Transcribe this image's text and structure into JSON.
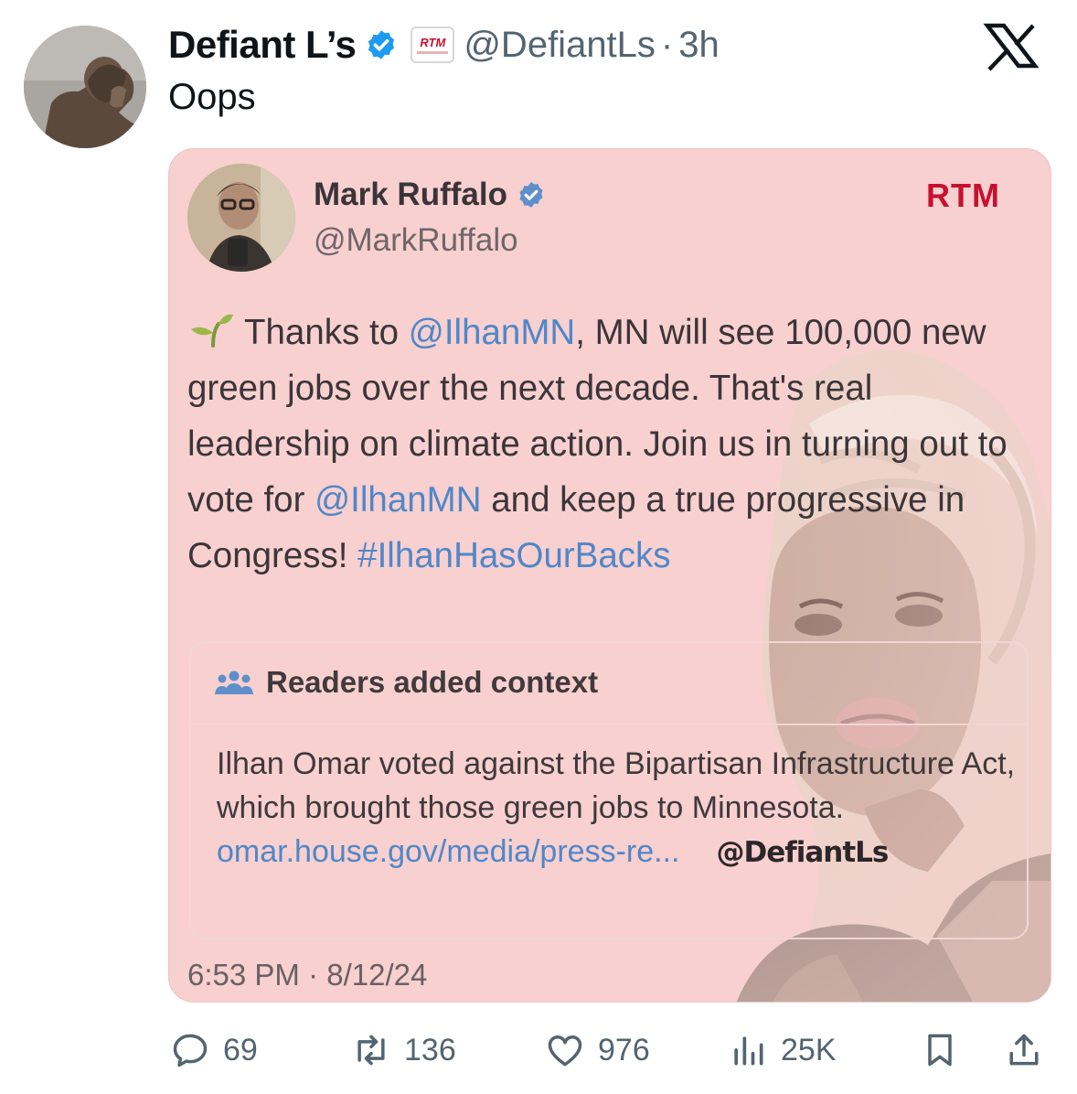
{
  "post": {
    "author_name": "Defiant L’s",
    "badge_text": "RTM",
    "handle": "@DefiantLs",
    "separator": "·",
    "time_ago": "3h",
    "text": "Oops"
  },
  "quoted_post": {
    "author_name": "Mark Ruffalo",
    "handle": "@MarkRuffalo",
    "brand_mark": "RTM",
    "emoji": "seedling",
    "body_segments": [
      {
        "text": " Thanks to ",
        "link": false
      },
      {
        "text": "@IlhanMN",
        "link": true
      },
      {
        "text": ", MN will see 100,000 new green jobs over the next decade. That's real leadership on climate action. Join us in turning out to vote for ",
        "link": false
      },
      {
        "text": "@IlhanMN",
        "link": true
      },
      {
        "text": " and keep a true progressive in Congress! ",
        "link": false
      },
      {
        "text": "#IlhanHasOurBacks",
        "link": true
      }
    ],
    "context": {
      "title": "Readers added context",
      "body": "Ilhan Omar voted against the Bipartisan Infrastructure Act, which brought those green jobs to Minnesota. ",
      "link_text": "omar.house.gov/media/press-re...",
      "watermark": "@DefiantLs"
    },
    "timestamp": "6:53 PM · 8/12/24"
  },
  "actions": {
    "replies": "69",
    "reposts": "136",
    "likes": "976",
    "views": "25K"
  },
  "colors": {
    "link": "#4f87c9",
    "verified": "#1d9bf0",
    "quote_bg": "#f7d0cf",
    "brand_red": "#c8102e",
    "secondary_text": "#536471"
  },
  "icons": [
    "verified-badge-icon",
    "x-logo-icon",
    "seedling-icon",
    "community-notes-icon",
    "reply-icon",
    "repost-icon",
    "like-icon",
    "views-icon",
    "bookmark-icon",
    "share-icon"
  ]
}
